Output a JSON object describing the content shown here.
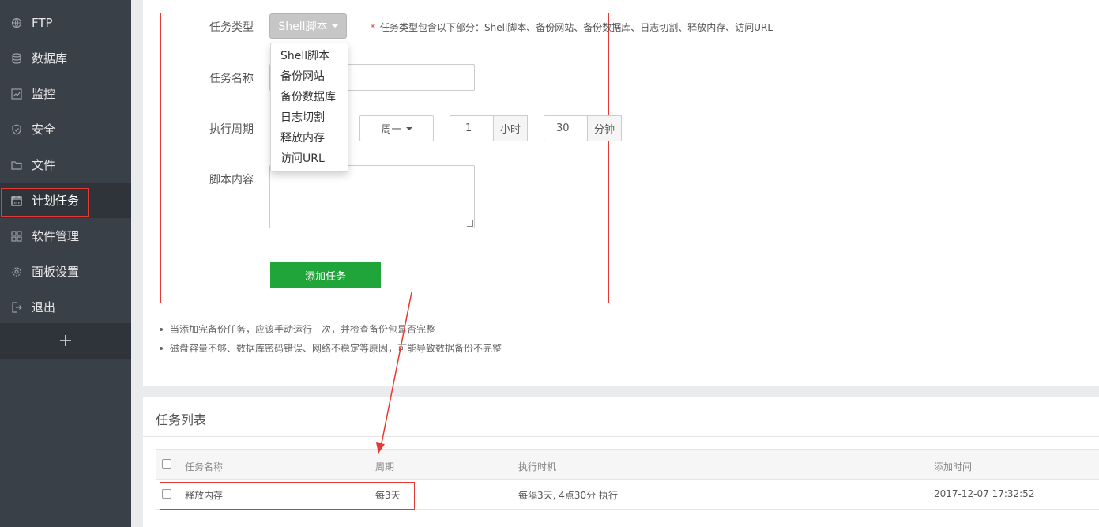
{
  "sidebar": {
    "items": [
      {
        "label": "FTP",
        "icon": "ftp-icon"
      },
      {
        "label": "数据库",
        "icon": "database-icon"
      },
      {
        "label": "监控",
        "icon": "monitor-icon"
      },
      {
        "label": "安全",
        "icon": "shield-icon"
      },
      {
        "label": "文件",
        "icon": "folder-icon"
      },
      {
        "label": "计划任务",
        "icon": "calendar-icon",
        "active": true
      },
      {
        "label": "软件管理",
        "icon": "grid-icon"
      },
      {
        "label": "面板设置",
        "icon": "gear-icon"
      },
      {
        "label": "退出",
        "icon": "logout-icon"
      }
    ],
    "add_label": "+"
  },
  "form": {
    "task_type_label": "任务类型",
    "task_type_value": "Shell脚本",
    "task_type_hint": "任务类型包含以下部分：Shell脚本、备份网站、备份数据库、日志切割、释放内存、访问URL",
    "task_type_options": [
      "Shell脚本",
      "备份网站",
      "备份数据库",
      "日志切割",
      "释放内存",
      "访问URL"
    ],
    "task_name_label": "任务名称",
    "task_name_value": "",
    "period_label": "执行周期",
    "weekday_value": "周一",
    "hour_value": "1",
    "hour_unit": "小时",
    "minute_value": "30",
    "minute_unit": "分钟",
    "script_label": "脚本内容",
    "submit_label": "添加任务"
  },
  "tips": [
    "当添加完备份任务，应该手动运行一次，并检查备份包是否完整",
    "磁盘容量不够、数据库密码错误、网络不稳定等原因，可能导致数据备份不完整"
  ],
  "task_list": {
    "title": "任务列表",
    "columns": [
      "任务名称",
      "周期",
      "执行时机",
      "添加时间"
    ],
    "rows": [
      {
        "name": "释放内存",
        "period": "每3天",
        "timing": "每隔3天, 4点30分 执行",
        "added": "2017-12-07 17:32:52"
      }
    ]
  },
  "colors": {
    "sidebar_bg": "#3a4047",
    "accent_green": "#20a53a",
    "highlight_red": "#e53935"
  }
}
